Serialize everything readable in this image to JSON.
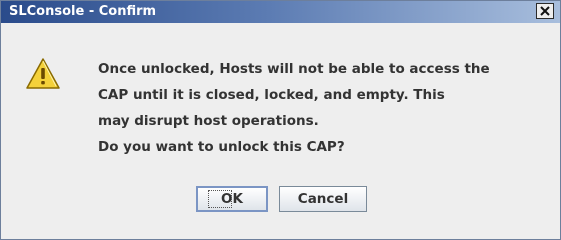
{
  "window": {
    "title": "SLConsole - Confirm",
    "close_icon": "close-icon"
  },
  "dialog": {
    "icon": "warning-icon",
    "message_lines": [
      "Once unlocked, Hosts will not be able to access the",
      "CAP until it is closed, locked, and empty. This",
      "may disrupt host operations.",
      "Do you want to unlock this CAP?"
    ]
  },
  "buttons": {
    "ok_label": "OK",
    "cancel_label": "Cancel"
  },
  "colors": {
    "titlebar_start": "#2a4b8b",
    "titlebar_end": "#a8bedd",
    "dialog_bg": "#eeeeee",
    "warning_yellow": "#f4d13a"
  }
}
